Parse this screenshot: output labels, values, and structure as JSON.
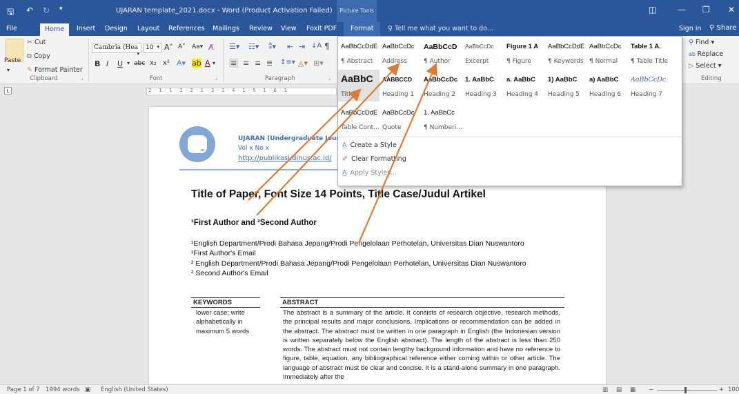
{
  "titlebar": {
    "doc_title": "UJARAN template_2021.docx - Word (Product Activation Failed)",
    "context_title": "Picture Tools"
  },
  "tabs": [
    "File",
    "Home",
    "Insert",
    "Design",
    "Layout",
    "References",
    "Mailings",
    "Review",
    "View",
    "Foxit PDF",
    "Format"
  ],
  "active_tab": "Home",
  "tellme": "Tell me what you want to do...",
  "signin": "Sign in",
  "share": "Share",
  "ribbon": {
    "clipboard": {
      "paste": "Paste",
      "cut": "Cut",
      "copy": "Copy",
      "format_painter": "Format Painter",
      "label": "Clipboard"
    },
    "font": {
      "name": "Cambria (Hea",
      "size": "10",
      "label": "Font"
    },
    "paragraph_label": "Paragraph",
    "editing": {
      "find": "Find",
      "replace": "Replace",
      "select": "Select",
      "label": "Editing"
    }
  },
  "ruler_ticks": "2 · 1 · 1 · 1 · 2 · 1 · 3 · 1 · 4 · 1 · 5 · 1 · 6 · 1",
  "styles_gallery": {
    "rows": [
      [
        {
          "preview": "AaBbCcDdE",
          "name": "¶ Abstract"
        },
        {
          "preview": "AaBbCcDc",
          "name": "Address"
        },
        {
          "preview": "AaBbCcD",
          "name": "¶ Author"
        },
        {
          "preview": "AaBbCcDc",
          "name": "Excerpt"
        },
        {
          "preview": "Figure 1 A",
          "name": "¶ Figure"
        },
        {
          "preview": "AaBbCcDdE",
          "name": "¶ Keywords"
        },
        {
          "preview": "AaBbCcDc",
          "name": "¶ Normal"
        },
        {
          "preview": "Table 1 A.",
          "name": "¶ Table Title"
        }
      ],
      [
        {
          "preview": "AaBbC",
          "name": "Title"
        },
        {
          "preview": "AABBCCD",
          "name": "Heading 1"
        },
        {
          "preview": "AaBbCcDc",
          "name": "Heading 2"
        },
        {
          "preview": "1. AaBbC",
          "name": "Heading 3"
        },
        {
          "preview": "a. AaBbC",
          "name": "Heading 4"
        },
        {
          "preview": "1) AaBbC",
          "name": "Heading 5"
        },
        {
          "preview": "a) AaBbC",
          "name": "Heading 6"
        },
        {
          "preview": "AaBbCcDc",
          "name": "Heading 7"
        }
      ],
      [
        {
          "preview": "AaBbCcDdE",
          "name": "Table Cont..."
        },
        {
          "preview": "AaBbCcDc",
          "name": "Quote"
        },
        {
          "preview": "1. AaBbCc",
          "name": "¶ Numberi..."
        }
      ]
    ],
    "menu": [
      "Create a Style",
      "Clear Formatting",
      "Apply Styles..."
    ]
  },
  "document": {
    "header_line1": "UJARAN (Undergraduate Journ",
    "header_line2": "Vol x No x",
    "header_link": "http://publikasi.dinus.ac.id/",
    "title": "Title of Paper, Font Size 14 Points, Title Case/Judul Artikel",
    "authors": "¹First Author and ²Second Author",
    "affiliations": [
      "¹English Department/Prodi Bahasa Jepang/Prodi Pengelolaan Perhotelan, Universitas Dian Nuswantoro",
      "¹First Author's Email",
      "² English Department/Prodi Bahasa Jepang/Prodi Pengelolaan Perhotelan, Universitas Dian Nuswantoro",
      "² Second Author's Email"
    ],
    "keywords_heading": "KEYWORDS",
    "abstract_heading": "ABSTRACT",
    "keywords_text": "lower case; write alphabetically in maximum 5 words",
    "abstract_text": "The abstract is a summary of the article. It consists of research objective, research methods, the principal results and major conclusions. Implications or recommendation can be added in the abstract. The abstract must be written in one paragraph in English (the Indonesian version is written separately below the English abstract). The length of the abstract is less than 250 words. The abstract must not contain lengthy background information and have no reference to figure, table, equation, any bibliographical reference either coming within or other article. The language of abstract must be clear and concise. It is a stand-alone summary in one paragraph. Immediately after the"
  },
  "status": {
    "page": "Page 1 of 7",
    "words": "1994 words",
    "language": "English (United States)",
    "zoom": "100"
  },
  "colors": {
    "accent": "#2b579a",
    "arrow": "#e07a2e"
  }
}
